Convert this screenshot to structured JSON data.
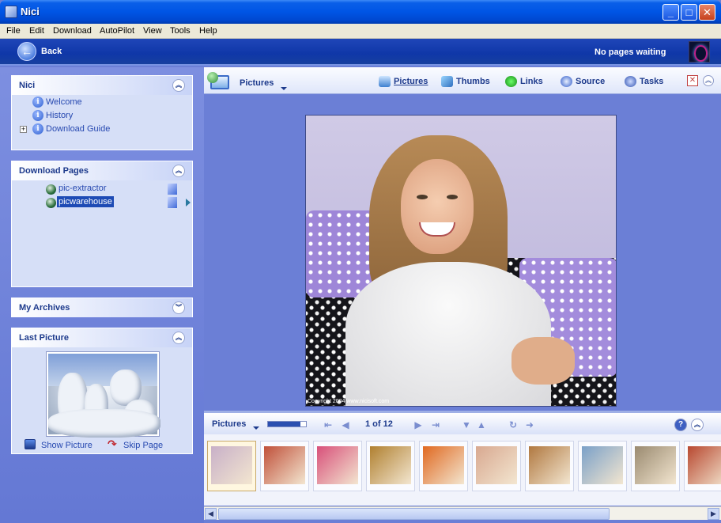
{
  "window": {
    "title": "Nici",
    "minimize": "_",
    "maximize": "□",
    "close": "✕"
  },
  "menu": [
    "File",
    "Edit",
    "Download",
    "AutoPilot",
    "View",
    "Tools",
    "Help"
  ],
  "nav": {
    "back_label": "Back",
    "back_arrow": "←",
    "status": "No pages waiting"
  },
  "nici_panel": {
    "title": "Nici",
    "items": [
      {
        "label": "Welcome",
        "icon": "info-icon"
      },
      {
        "label": "History",
        "icon": "info-icon"
      },
      {
        "label": "Download Guide",
        "icon": "info-icon",
        "expander": "+"
      }
    ]
  },
  "download_panel": {
    "title": "Download Pages",
    "items": [
      {
        "label": "pic-extractor",
        "selected": false
      },
      {
        "label": "picwarehouse",
        "selected": true
      }
    ]
  },
  "archives_panel": {
    "title": "My Archives"
  },
  "last_picture_panel": {
    "title": "Last Picture",
    "show_label": "Show Picture",
    "skip_label": "Skip Page"
  },
  "toolbar": {
    "view_label": "Pictures",
    "tabs": [
      {
        "label": "Pictures",
        "icon": "pictures-icon",
        "active": true
      },
      {
        "label": "Thumbs",
        "icon": "thumbs-icon",
        "active": false
      },
      {
        "label": "Links",
        "icon": "links-icon",
        "active": false
      },
      {
        "label": "Source",
        "icon": "source-icon",
        "active": false
      },
      {
        "label": "Tasks",
        "icon": "tasks-icon",
        "active": false
      }
    ]
  },
  "picture": {
    "copyright": "Copyright 2004 www.nicisoft.com"
  },
  "filmstrip": {
    "label": "Pictures",
    "counter": "1 of 12",
    "progress": 0.85,
    "help": "?",
    "thumbs": [
      {
        "name": "girl-portrait",
        "color": "#c8b0c8",
        "selected": true
      },
      {
        "name": "red-canyon",
        "color": "#c0503a"
      },
      {
        "name": "pink-flowers",
        "color": "#d8507a"
      },
      {
        "name": "lion",
        "color": "#b08030"
      },
      {
        "name": "orange-flowers",
        "color": "#e06820"
      },
      {
        "name": "woman-standing",
        "color": "#d8a890"
      },
      {
        "name": "deer",
        "color": "#b07840"
      },
      {
        "name": "pelican",
        "color": "#7aa0c8"
      },
      {
        "name": "rhino",
        "color": "#9a8a70"
      },
      {
        "name": "red-rocks",
        "color": "#b84830"
      }
    ]
  },
  "colors": {
    "accent": "#1d3a8c",
    "background": "#6b7fd6",
    "titlebar": "#0055e5"
  }
}
